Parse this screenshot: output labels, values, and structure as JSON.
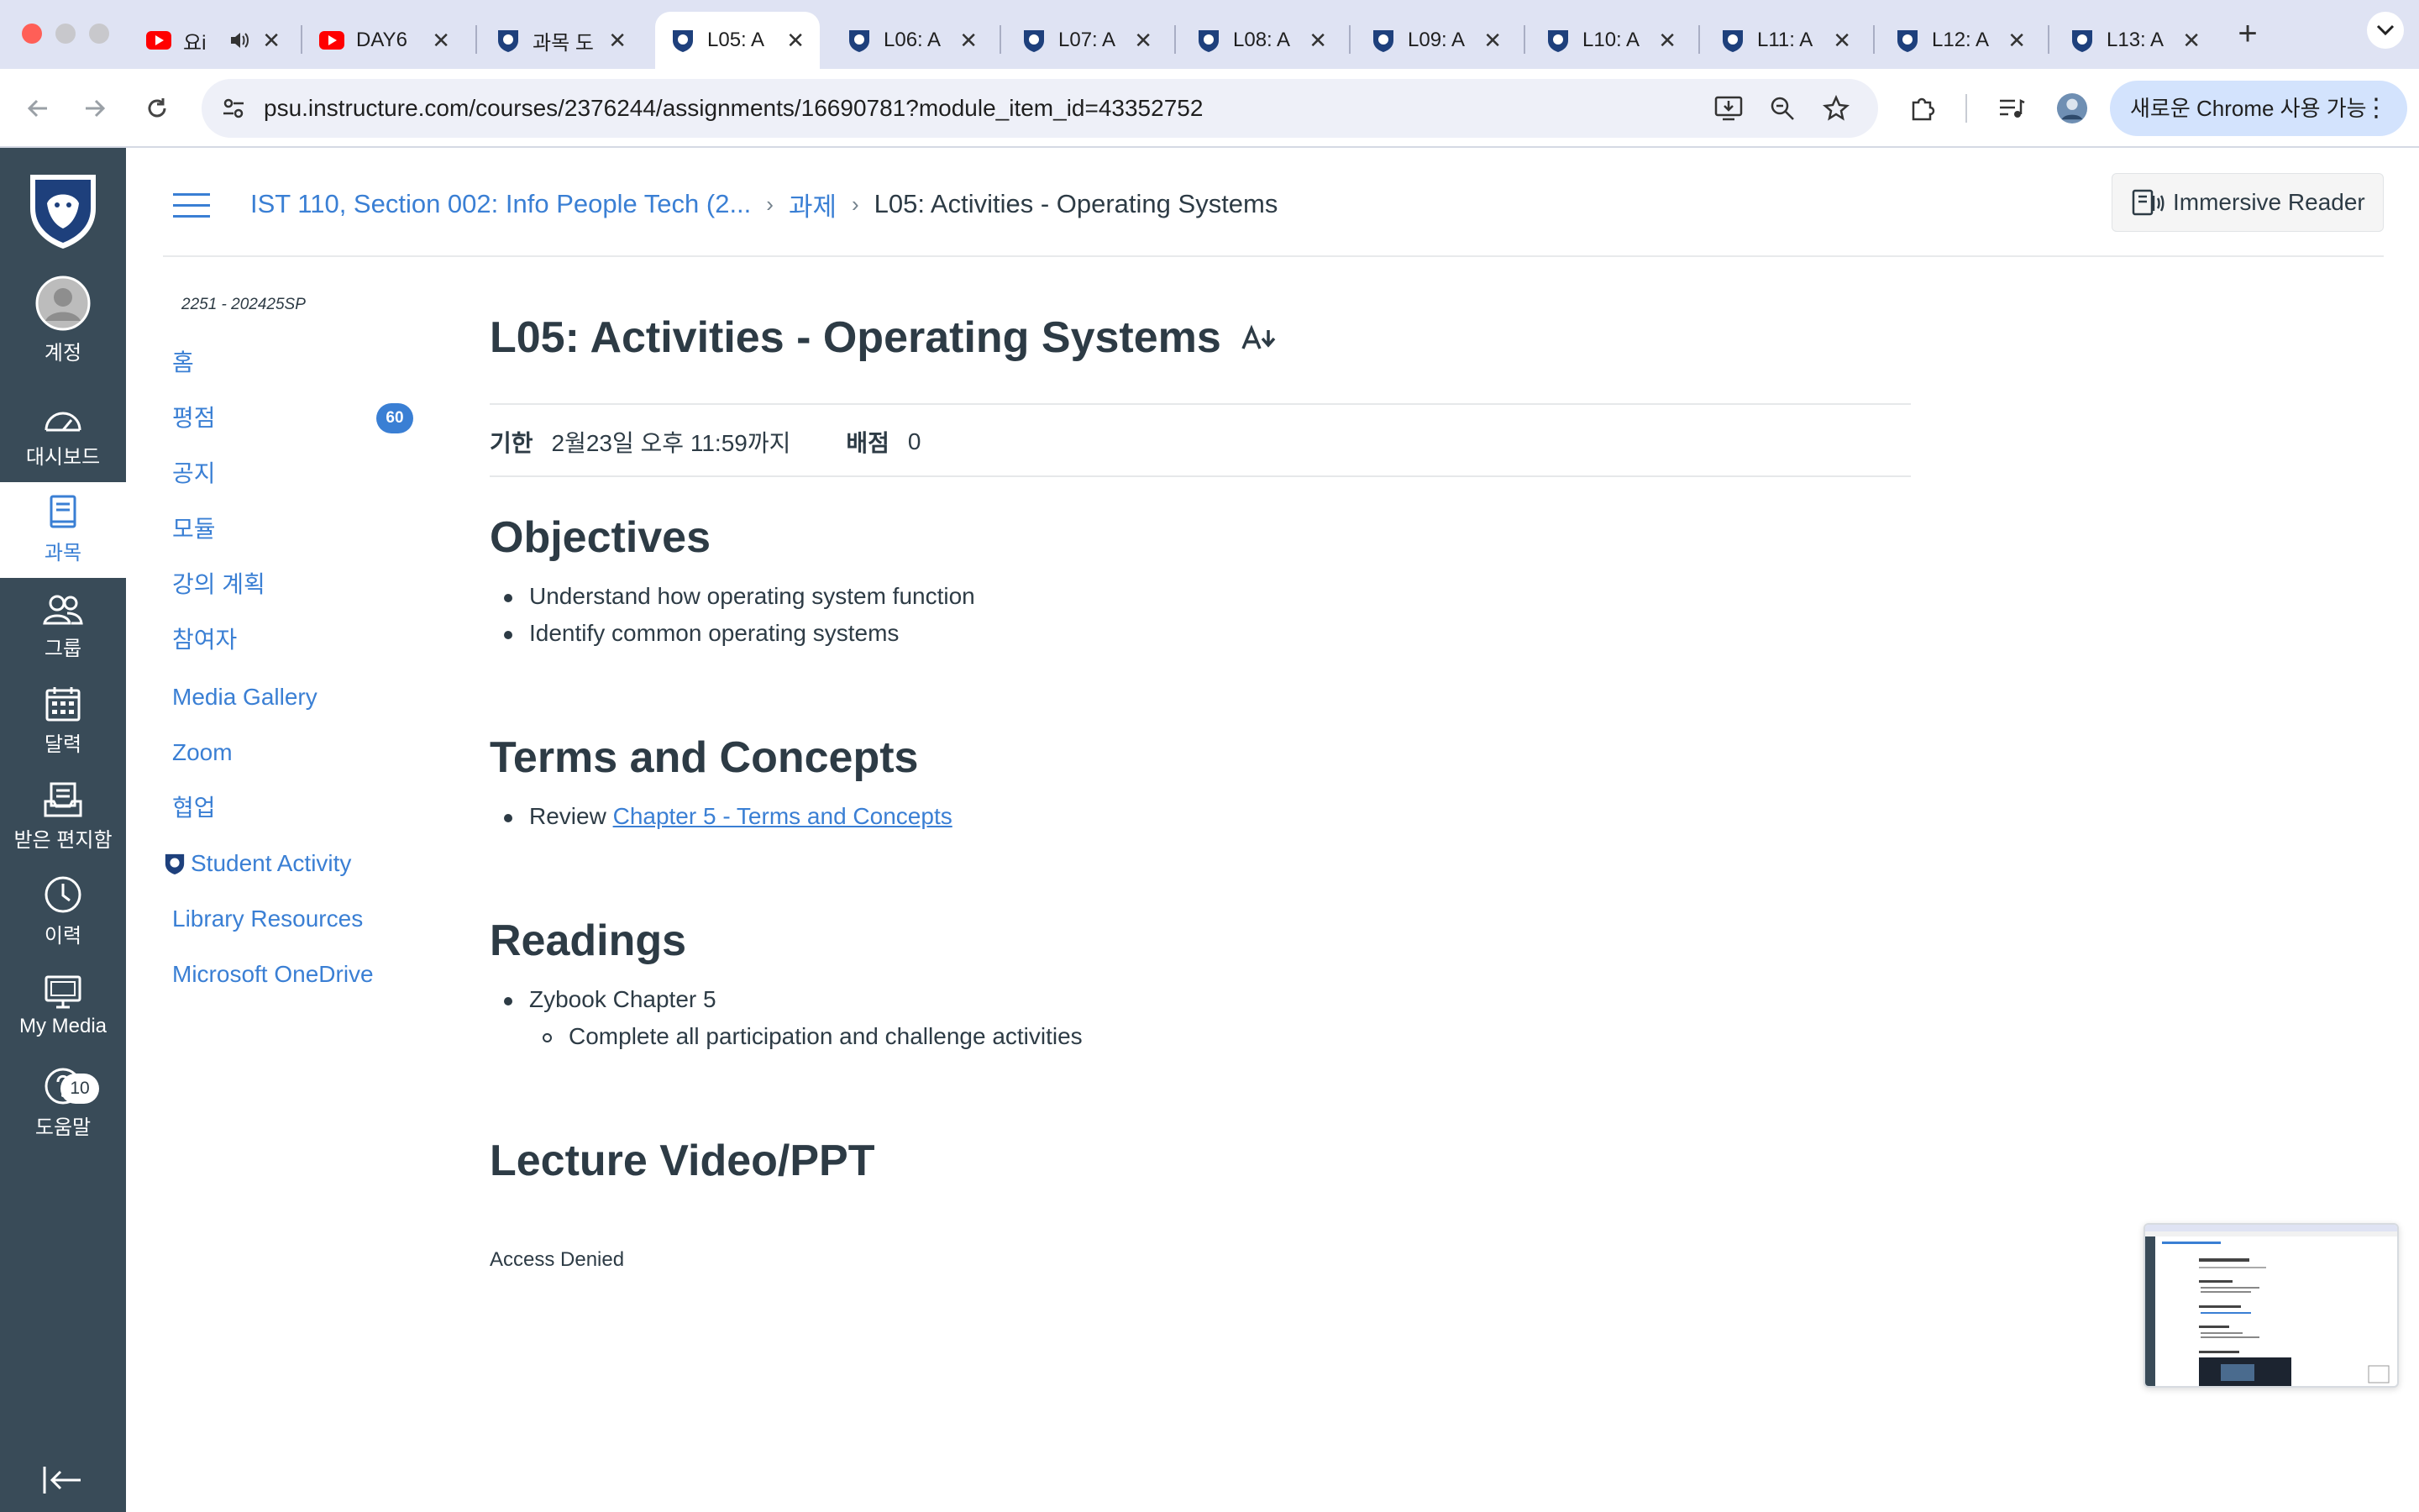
{
  "browser": {
    "tabs": [
      {
        "title": "요i",
        "favicon": "youtube-icon",
        "audio": true
      },
      {
        "title": "DAY6",
        "favicon": "youtube-icon"
      },
      {
        "title": "과목 도",
        "favicon": "psu-shield-icon"
      },
      {
        "title": "L05: A",
        "favicon": "psu-shield-icon",
        "active": true
      },
      {
        "title": "L06: A",
        "favicon": "psu-shield-icon"
      },
      {
        "title": "L07: A",
        "favicon": "psu-shield-icon"
      },
      {
        "title": "L08: A",
        "favicon": "psu-shield-icon"
      },
      {
        "title": "L09: A",
        "favicon": "psu-shield-icon"
      },
      {
        "title": "L10: A",
        "favicon": "psu-shield-icon"
      },
      {
        "title": "L11: A",
        "favicon": "psu-shield-icon"
      },
      {
        "title": "L12: A",
        "favicon": "psu-shield-icon"
      },
      {
        "title": "L13: A",
        "favicon": "psu-shield-icon"
      }
    ],
    "url": "psu.instructure.com/courses/2376244/assignments/16690781?module_item_id=43352752",
    "chrome_pill": "새로운 Chrome 사용 가능",
    "accent": "#dfe3f3"
  },
  "global_nav": {
    "items": [
      {
        "label": "계정",
        "icon": "account-avatar-icon"
      },
      {
        "label": "대시보드",
        "icon": "dashboard-icon"
      },
      {
        "label": "과목",
        "icon": "courses-icon",
        "active": true
      },
      {
        "label": "그룹",
        "icon": "groups-icon"
      },
      {
        "label": "달력",
        "icon": "calendar-icon"
      },
      {
        "label": "받은 편지함",
        "icon": "inbox-icon"
      },
      {
        "label": "이력",
        "icon": "history-icon"
      },
      {
        "label": "My Media",
        "icon": "my-media-icon"
      },
      {
        "label": "도움말",
        "icon": "help-icon",
        "badge": "10"
      }
    ],
    "background": "#394b58"
  },
  "header": {
    "breadcrumbs": [
      "IST 110, Section 002: Info People Tech (2...",
      "과제",
      "L05: Activities - Operating Systems"
    ],
    "immersive_reader": "Immersive Reader"
  },
  "course_nav": {
    "term": "2251 - 202425SP",
    "items": [
      {
        "label": "홈"
      },
      {
        "label": "평점",
        "badge": "60"
      },
      {
        "label": "공지"
      },
      {
        "label": "모듈"
      },
      {
        "label": "강의 계획"
      },
      {
        "label": "참여자"
      },
      {
        "label": "Media Gallery"
      },
      {
        "label": "Zoom"
      },
      {
        "label": "협업"
      },
      {
        "label": "Student Activity",
        "icon": "psu-shield-icon"
      },
      {
        "label": "Library Resources"
      },
      {
        "label": "Microsoft OneDrive"
      }
    ],
    "link_color": "#3a7fd4"
  },
  "assignment": {
    "title": "L05: Activities - Operating Systems",
    "due_label": "기한",
    "due_value": "2월23일 오후 11:59까지",
    "points_label": "배점",
    "points_value": "0",
    "sections": {
      "objectives": {
        "heading": "Objectives",
        "items": [
          "Understand how operating system function",
          "Identify common operating systems"
        ]
      },
      "terms": {
        "heading": "Terms and Concepts",
        "prefix": "Review",
        "link": "Chapter 5 - Terms and Concepts"
      },
      "readings": {
        "heading": "Readings",
        "item": "Zybook Chapter 5",
        "subitem": "Complete all participation and challenge activities"
      },
      "lecture": {
        "heading": "Lecture Video/PPT",
        "message": "Access Denied"
      }
    }
  }
}
